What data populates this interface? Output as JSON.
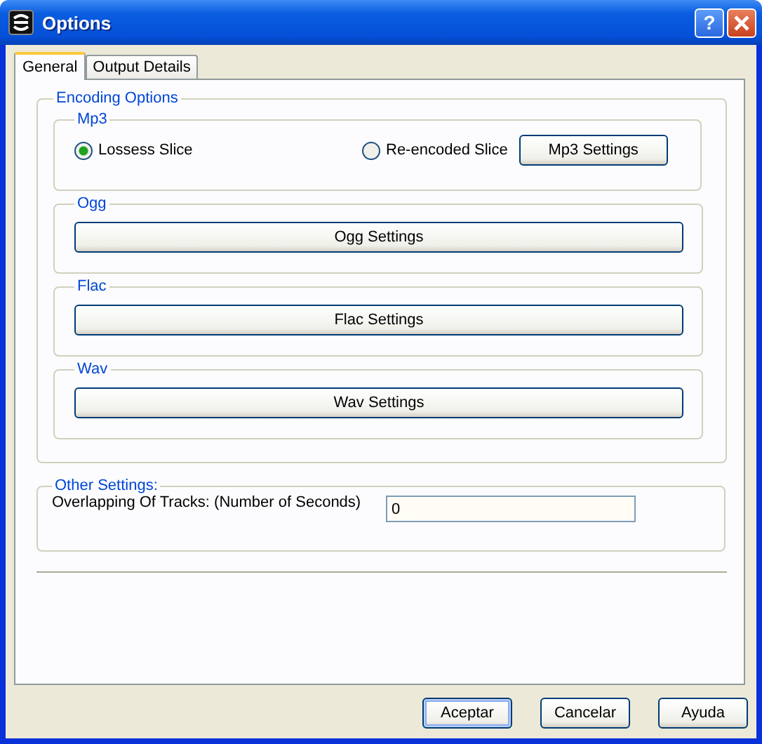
{
  "window": {
    "title": "Options",
    "help_button": "?"
  },
  "tabs": [
    {
      "label": "General",
      "selected": true
    },
    {
      "label": "Output Details",
      "selected": false
    }
  ],
  "encoding": {
    "legend": "Encoding Options",
    "groups": [
      {
        "kind": "radio",
        "legend": "Mp3",
        "options": [
          {
            "label": "Lossess Slice",
            "selected": true
          },
          {
            "label": "Re-encoded Slice",
            "selected": false
          }
        ],
        "button": "Mp3 Settings"
      },
      {
        "kind": "button",
        "legend": "Ogg",
        "button": "Ogg Settings"
      },
      {
        "kind": "button",
        "legend": "Flac",
        "button": "Flac Settings"
      },
      {
        "kind": "button",
        "legend": "Wav",
        "button": "Wav Settings"
      }
    ]
  },
  "other": {
    "legend": "Other Settings:",
    "label": "Overlapping Of Tracks: (Number of Seconds)",
    "value": "0"
  },
  "buttons": [
    {
      "label": "Aceptar",
      "selected": true
    },
    {
      "label": "Cancelar",
      "selected": false
    },
    {
      "label": "Ayuda",
      "selected": false
    }
  ]
}
